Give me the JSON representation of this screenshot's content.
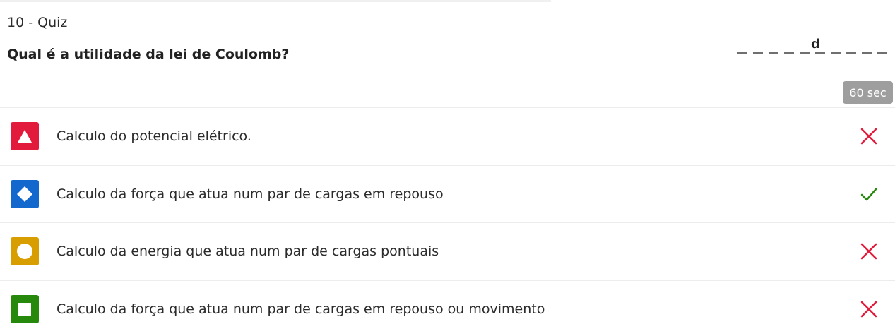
{
  "quiz": {
    "header": "10 - Quiz",
    "question": "Qual é a utilidade da lei de Coulomb?"
  },
  "answer": {
    "letter": "d"
  },
  "timer": {
    "label": "60 sec"
  },
  "options": [
    {
      "text": "Calculo do potencial elétrico.",
      "shape": "triangle-icon",
      "color": "#e21b3c",
      "result": "incorrect"
    },
    {
      "text": "Calculo da força que atua num par de cargas em repouso",
      "shape": "diamond-icon",
      "color": "#1368ce",
      "result": "correct"
    },
    {
      "text": "Calculo da energia que atua num par de cargas pontuais",
      "shape": "circle-icon",
      "color": "#d89e00",
      "result": "incorrect"
    },
    {
      "text": "Calculo da força que atua num par de cargas em repouso ou movimento",
      "shape": "square-icon",
      "color": "#26890c",
      "result": "incorrect"
    }
  ],
  "colors": {
    "incorrect": "#e21b3c",
    "correct": "#26890c",
    "timer_bg": "#9e9e9e"
  }
}
